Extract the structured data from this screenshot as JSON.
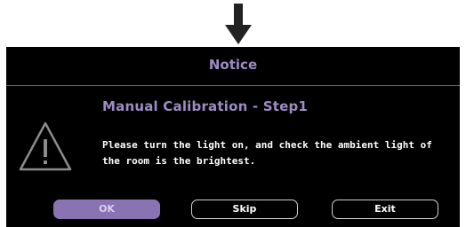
{
  "dialog": {
    "title": "Notice",
    "subtitle": "Manual Calibration - Step1",
    "message": "Please turn the light on, and check the ambient light of the room is the brightest.",
    "icon": "warning-icon"
  },
  "buttons": {
    "ok_label": "OK",
    "skip_label": "Skip",
    "exit_label": "Exit"
  },
  "colors": {
    "accent": "#9f8bc4",
    "ok_button": "#8a73b3",
    "background": "#000000"
  }
}
